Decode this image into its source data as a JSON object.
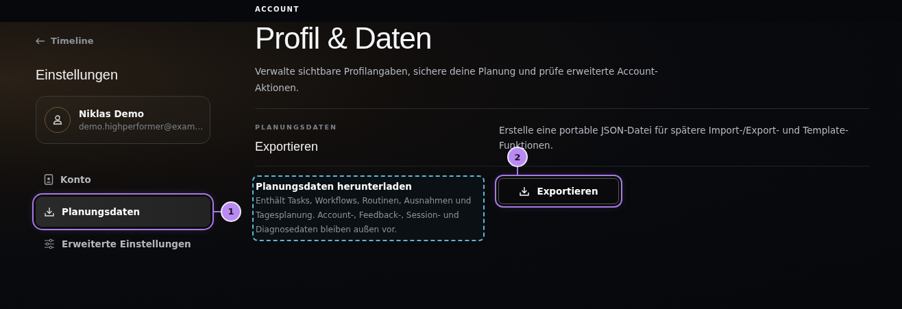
{
  "top_bar": {
    "eyebrow": "ACCOUNT"
  },
  "sidebar": {
    "back_link": "Timeline",
    "title": "Einstellungen",
    "profile": {
      "name": "Niklas Demo",
      "email": "demo.highperformer@exam…"
    },
    "items": [
      {
        "label": "Konto",
        "kind": "account",
        "selected": false,
        "highlighted": false
      },
      {
        "label": "Planungsdaten",
        "kind": "download",
        "selected": true,
        "highlighted": true,
        "step": "1"
      },
      {
        "label": "Erweiterte Einstellungen",
        "kind": "sliders",
        "selected": false,
        "highlighted": false
      }
    ]
  },
  "main": {
    "title": "Profil & Daten",
    "description": "Verwalte sichtbare Profilangaben, sichere deine Planung und prüfe erweiterte Account-Aktionen.",
    "section": {
      "eyebrow": "PLANUNGSDATEN",
      "title": "Exportieren",
      "description": "Erstelle eine portable JSON-Datei für spätere Import-/Export- und Template-Funktionen.",
      "info": {
        "title": "Planungsdaten herunterladen",
        "text": "Enthält Tasks, Workflows, Routinen, Ausnahmen und Tagesplanung. Account-, Feedback-, Session- und Diagnosedaten bleiben außen vor.",
        "outlined": true
      },
      "button": {
        "label": "Exportieren",
        "highlighted": true,
        "step": "2"
      }
    }
  }
}
